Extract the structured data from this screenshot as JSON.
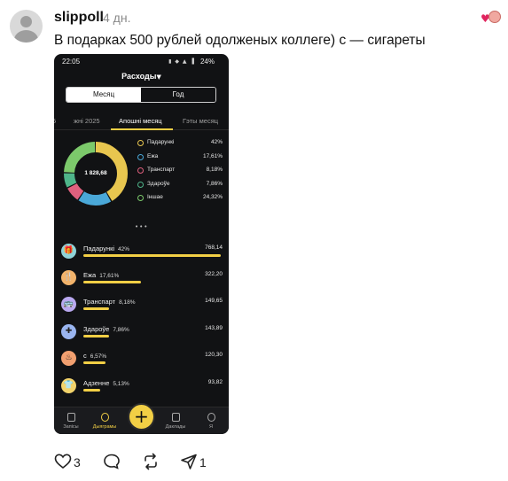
{
  "post": {
    "author": "slippoll",
    "time": "4 дн.",
    "message": "В подарках 500 рублей одолженых коллеге) с — сигареты"
  },
  "phone": {
    "status": {
      "time": "22:05",
      "battery": "24%"
    },
    "title": "Расходы",
    "title_caret": "▼",
    "period_toggle": {
      "options": [
        "Месяц",
        "Год"
      ],
      "selected": "Месяц"
    },
    "tabs": [
      "5",
      "жні 2025",
      "Апошні месяц",
      "Гэты месяц"
    ],
    "active_tab": "Апошні месяц",
    "donut": {
      "total": "1 828,68",
      "segments": [
        {
          "name": "Падарункі",
          "pct": 42,
          "color": "#e8c64f"
        },
        {
          "name": "Ежа",
          "pct": 17.61,
          "color": "#4aa8d8"
        },
        {
          "name": "Транспарт",
          "pct": 8.18,
          "color": "#e0607e"
        },
        {
          "name": "Здароўе",
          "pct": 7.86,
          "color": "#4fb58a"
        },
        {
          "name": "Іншае",
          "pct": 24.32,
          "color": "#7cc96b"
        }
      ]
    },
    "legend": [
      {
        "name": "Падарункі",
        "pct": "42%",
        "color": "#e8c64f"
      },
      {
        "name": "Ежа",
        "pct": "17,61%",
        "color": "#4aa8d8"
      },
      {
        "name": "Транспарт",
        "pct": "8,18%",
        "color": "#e0607e"
      },
      {
        "name": "Здароўе",
        "pct": "7,86%",
        "color": "#4fb58a"
      },
      {
        "name": "Іншае",
        "pct": "24,32%",
        "color": "#7cc96b"
      }
    ],
    "page_dots": "•••",
    "categories": [
      {
        "name": "Падарункі",
        "pct": "42%",
        "amount": "768,14",
        "fill": 1.0,
        "icon": "gift-icon",
        "glyph": "🎁",
        "color": "#8fd3d8"
      },
      {
        "name": "Ежа",
        "pct": "17,61%",
        "amount": "322,20",
        "fill": 0.42,
        "icon": "food-icon",
        "glyph": "🍴",
        "color": "#f2b36b"
      },
      {
        "name": "Транспарт",
        "pct": "8,18%",
        "amount": "149,65",
        "fill": 0.19,
        "icon": "bus-icon",
        "glyph": "🚌",
        "color": "#b9a8f0"
      },
      {
        "name": "Здароўе",
        "pct": "7,86%",
        "amount": "143,89",
        "fill": 0.19,
        "icon": "health-icon",
        "glyph": "✚",
        "color": "#9ab5f0"
      },
      {
        "name": "с",
        "pct": "6,57%",
        "amount": "120,30",
        "fill": 0.16,
        "icon": "cigarette-icon",
        "glyph": "♨",
        "color": "#f2a070"
      },
      {
        "name": "Адзенне",
        "pct": "5,13%",
        "amount": "93,82",
        "fill": 0.12,
        "icon": "clothes-icon",
        "glyph": "👕",
        "color": "#f2d36b"
      }
    ],
    "nav": {
      "items": [
        "Запісы",
        "Дыяграмы",
        "Даклады",
        "Я"
      ],
      "active": "Дыяграмы",
      "fab": "+"
    }
  },
  "actions": {
    "likes": "3",
    "shares": "1"
  }
}
